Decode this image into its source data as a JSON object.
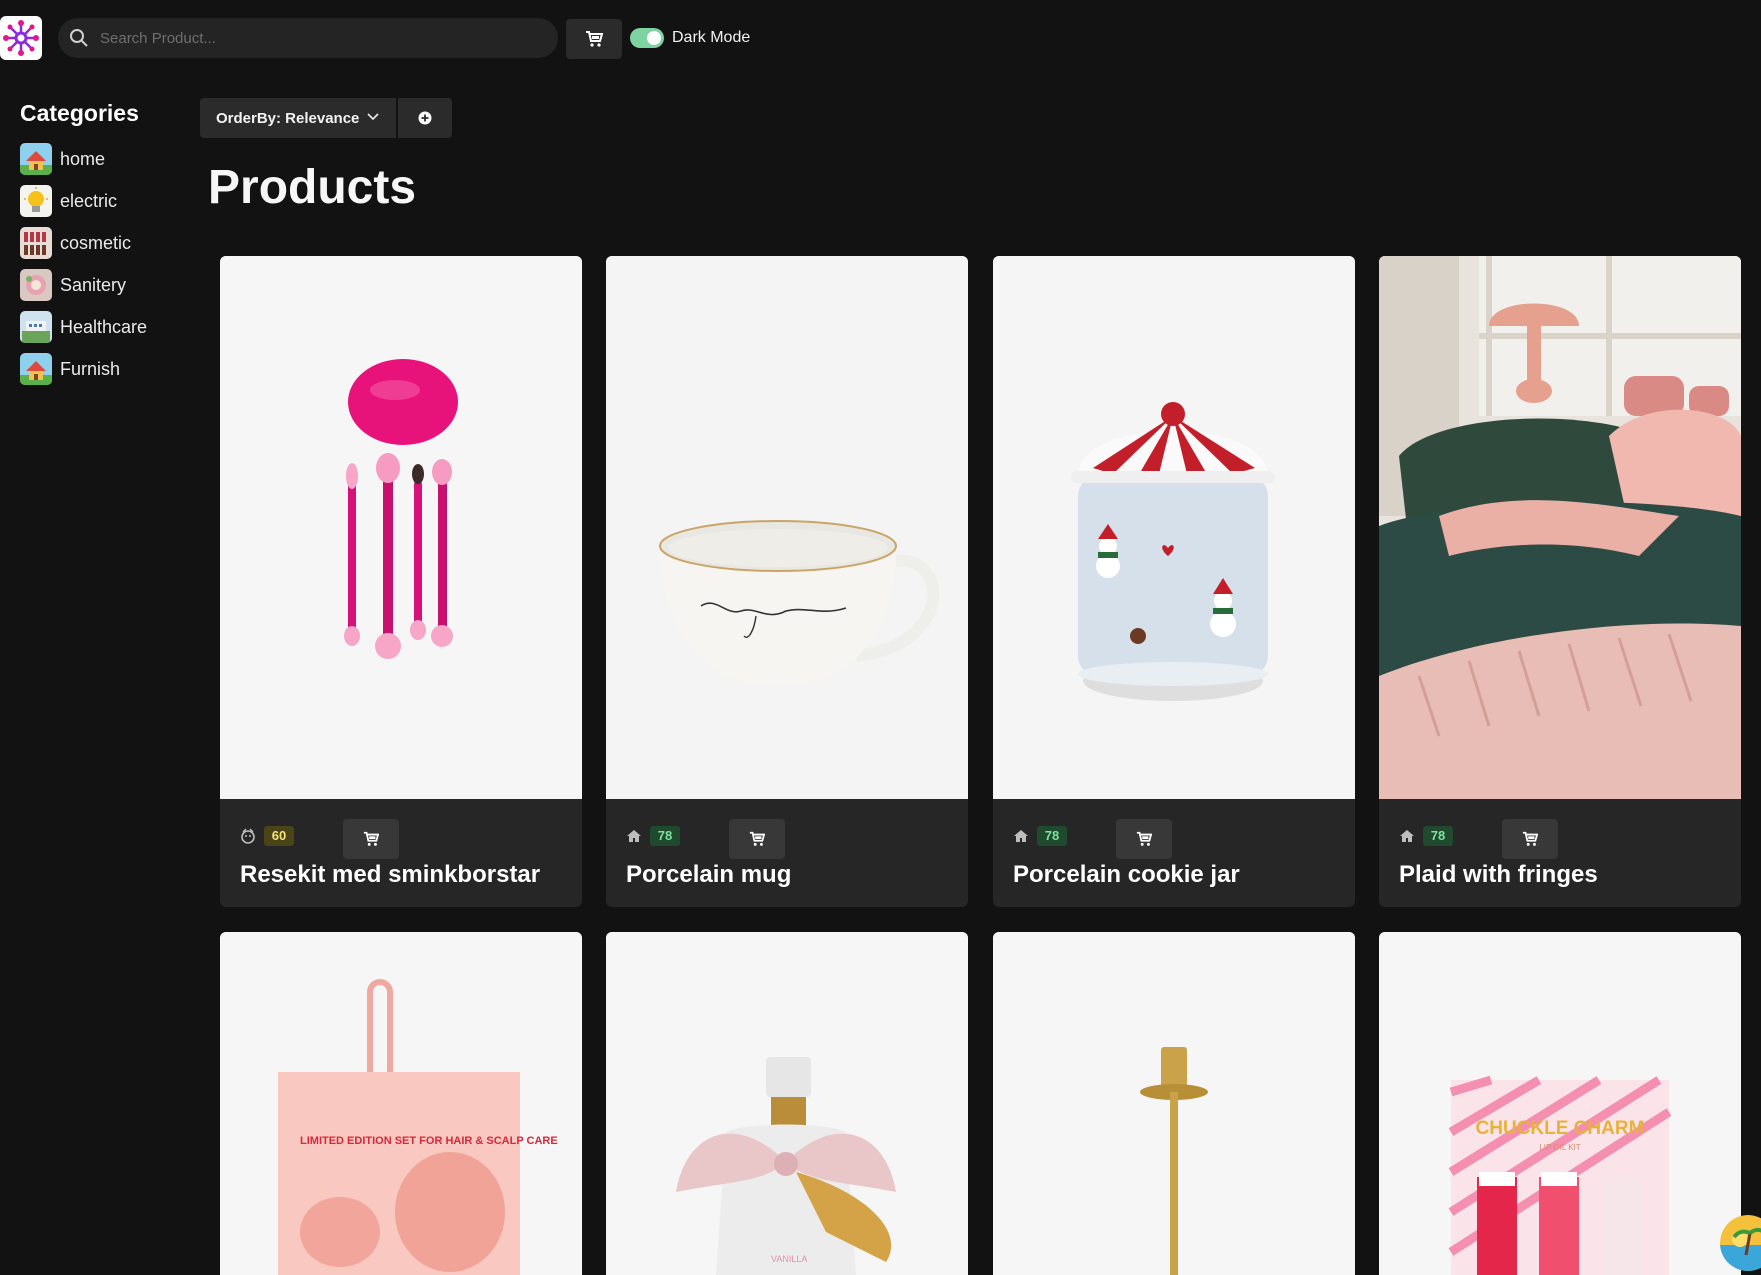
{
  "header": {
    "search_placeholder": "Search Product...",
    "dark_mode_label": "Dark Mode",
    "dark_mode_on": true
  },
  "sidebar": {
    "title": "Categories",
    "items": [
      {
        "label": "home"
      },
      {
        "label": "electric"
      },
      {
        "label": "cosmetic"
      },
      {
        "label": "Sanitery"
      },
      {
        "label": "Healthcare"
      },
      {
        "label": "Furnish"
      }
    ]
  },
  "controls": {
    "orderby_label": "OrderBy: Relevance"
  },
  "main": {
    "title": "Products",
    "products": [
      {
        "name": "Resekit med sminkborstar",
        "count": "60",
        "category_icon": "cosmetic-icon",
        "badge_color": "#f3e37a"
      },
      {
        "name": "Porcelain mug",
        "count": "78",
        "category_icon": "home-icon",
        "badge_color": "#7fe0a2"
      },
      {
        "name": "Porcelain cookie jar",
        "count": "78",
        "category_icon": "home-icon",
        "badge_color": "#7fe0a2"
      },
      {
        "name": "Plaid with fringes",
        "count": "78",
        "category_icon": "home-icon",
        "badge_color": "#7fe0a2"
      }
    ],
    "row2_texts": {
      "scalp_set": "LIMITED EDITION SET FOR HAIR & SCALP CARE",
      "mist_label": "VANILLA",
      "lip_kit_title": "CHUCKLE CHARM",
      "lip_kit_sub": "LIP OIL KIT"
    }
  },
  "colors": {
    "background": "#121212",
    "card": "#262626",
    "accent_toggle": "#7fd3a1"
  }
}
